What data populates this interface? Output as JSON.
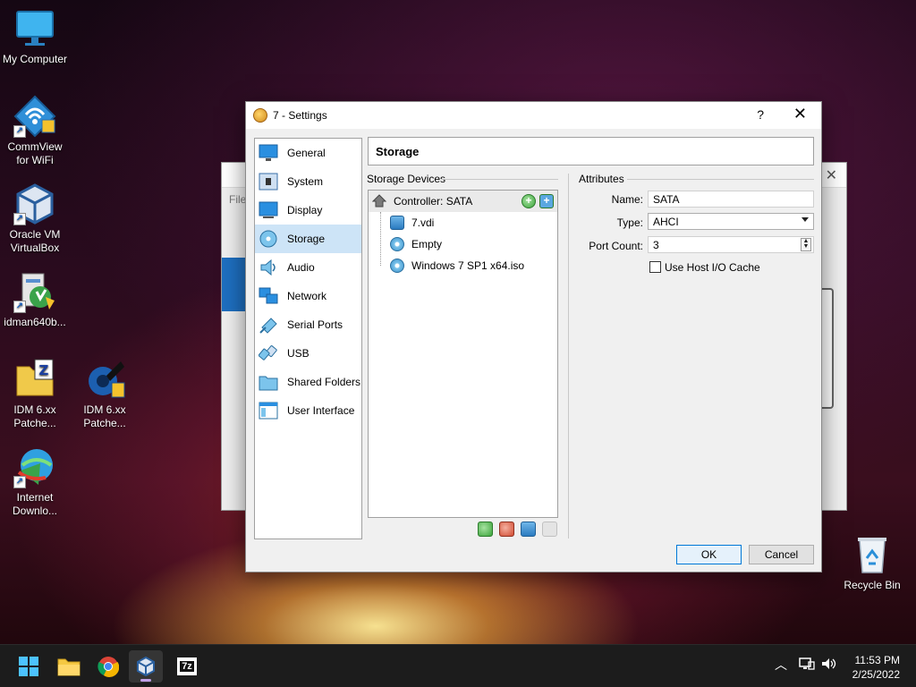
{
  "desktop": {
    "icons": [
      {
        "label": "My Computer"
      },
      {
        "label": "CommView for WiFi"
      },
      {
        "label": "Oracle VM VirtualBox"
      },
      {
        "label": "idman640b..."
      },
      {
        "label": "IDM 6.xx Patche..."
      },
      {
        "label": "IDM 6.xx Patche..."
      },
      {
        "label": "Internet Downlo..."
      },
      {
        "label": "Recycle Bin"
      }
    ]
  },
  "background_window": {
    "menu_text": "File"
  },
  "dialog": {
    "title": "7 - Settings",
    "help": "?",
    "close": "✕",
    "nav": [
      {
        "label": "General",
        "icon": "general-icon"
      },
      {
        "label": "System",
        "icon": "system-icon"
      },
      {
        "label": "Display",
        "icon": "display-icon"
      },
      {
        "label": "Storage",
        "icon": "storage-icon"
      },
      {
        "label": "Audio",
        "icon": "audio-icon"
      },
      {
        "label": "Network",
        "icon": "network-icon"
      },
      {
        "label": "Serial Ports",
        "icon": "serial-ports-icon"
      },
      {
        "label": "USB",
        "icon": "usb-icon"
      },
      {
        "label": "Shared Folders",
        "icon": "shared-folders-icon"
      },
      {
        "label": "User Interface",
        "icon": "user-interface-icon"
      }
    ],
    "selected_nav": "Storage",
    "page_title": "Storage",
    "storage_devices": {
      "label": "Storage Devices",
      "controller": "Controller: SATA",
      "items": [
        {
          "label": "7.vdi",
          "type": "hdd"
        },
        {
          "label": "Empty",
          "type": "optical"
        },
        {
          "label": "Windows 7 SP1 x64.iso",
          "type": "optical"
        }
      ]
    },
    "attributes": {
      "label": "Attributes",
      "name_label": "Name:",
      "name_value": "SATA",
      "type_label": "Type:",
      "type_value": "AHCI",
      "port_count_label": "Port Count:",
      "port_count_value": "3",
      "host_io_cache_label": "Use Host I/O Cache",
      "host_io_cache_checked": false
    },
    "ok_label": "OK",
    "cancel_label": "Cancel"
  },
  "taskbar": {
    "time": "11:53 PM",
    "date": "2/25/2022",
    "apps": [
      "start-icon",
      "file-explorer-icon",
      "chrome-icon",
      "virtualbox-icon",
      "7zip-icon"
    ],
    "seven_zip_text": "7z"
  },
  "colors": {
    "selection": "#cde4f7",
    "accent": "#0078d7",
    "taskbar": "#1c1c1c"
  }
}
